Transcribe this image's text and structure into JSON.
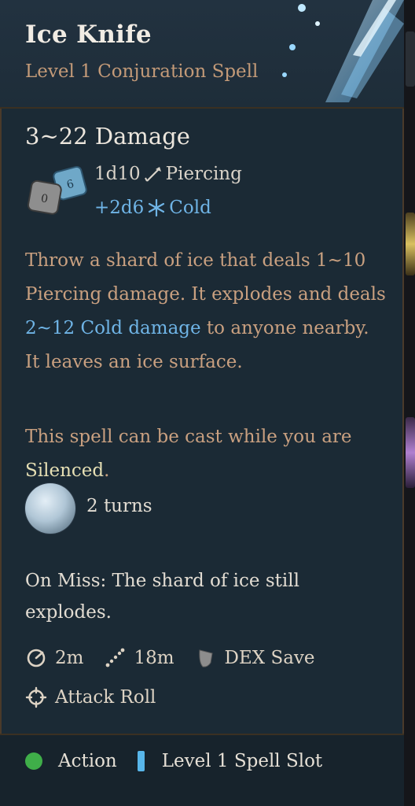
{
  "spell": {
    "name": "Ice Knife",
    "subtitle": "Level 1 Conjuration Spell"
  },
  "damage": {
    "title": "3~22 Damage",
    "primary_dice": "1d10",
    "primary_type": "Piercing",
    "primary_icon": "arrow-icon",
    "secondary_dice": "+2d6",
    "secondary_type": "Cold",
    "secondary_icon": "snowflake-icon"
  },
  "description": {
    "part1": "Throw a shard of ice that deals 1~10 Piercing damage. It explodes and deals ",
    "cold_text": "2~12 Cold damage",
    "part2": " to anyone nearby. It leaves an ice surface."
  },
  "silence_note": {
    "part1": "This spell can be cast while you are ",
    "keyword": "Silenced",
    "part2": "."
  },
  "duration": {
    "text": "2 turns",
    "icon": "ice-surface-icon"
  },
  "on_miss": "On Miss: The shard of ice still explodes.",
  "properties": {
    "range": "2m",
    "aoe": "18m",
    "save": "DEX Save",
    "roll": "Attack Roll"
  },
  "cost": {
    "action": "Action",
    "slot": "Level 1 Spell Slot"
  },
  "colors": {
    "cold": "#6fb4e6",
    "subtitle": "#c39a78",
    "action_dot": "#3fae49",
    "spell_slot": "#58b6ea"
  }
}
